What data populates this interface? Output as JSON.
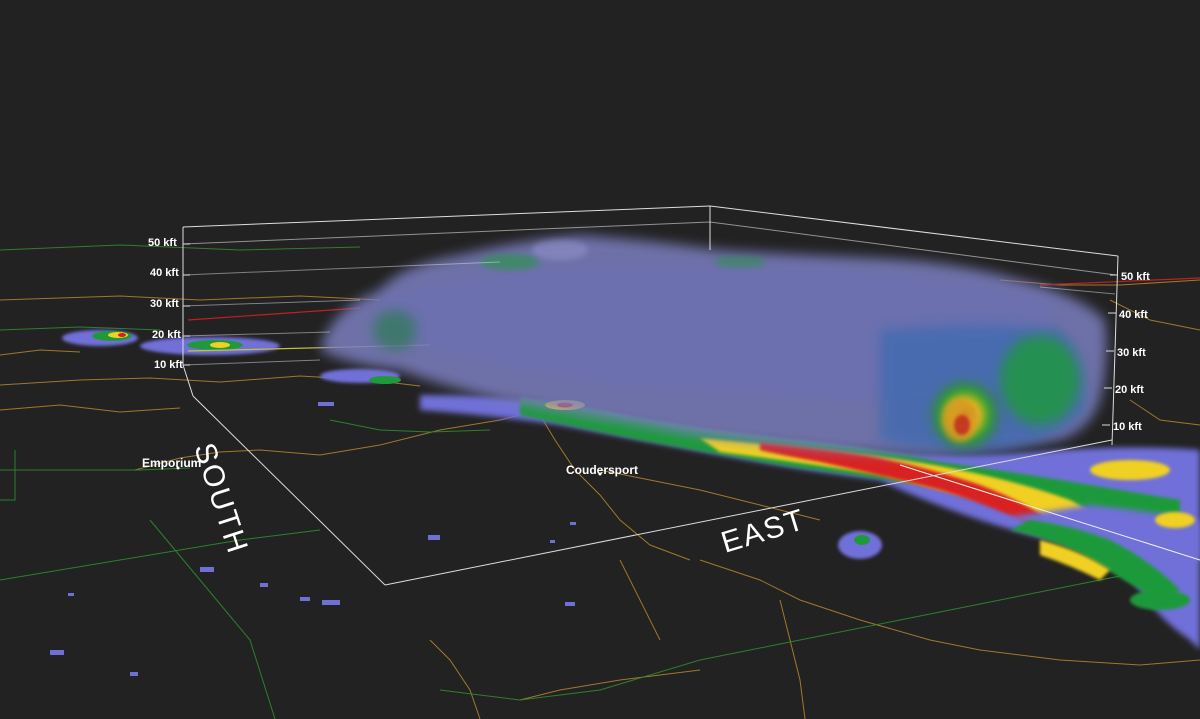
{
  "altitude_labels": {
    "left": [
      "50 kft",
      "40 kft",
      "30 kft",
      "20 kft",
      "10 kft"
    ],
    "right": [
      "50 kft",
      "40 kft",
      "30 kft",
      "20 kft",
      "10 kft"
    ]
  },
  "places": {
    "emporium": "Emporium",
    "coudersport": "Coudersport"
  },
  "compass": {
    "south": "SOUTH",
    "east": "EAST"
  },
  "colors": {
    "background": "#222222",
    "box_lines": "#dddddd",
    "county_lines": "#b8862e",
    "state_lines": "#2f8a2f",
    "reflectivity_low": "#6f6fd8",
    "reflectivity_mid": "#1f9a3a",
    "reflectivity_high": "#f0d020",
    "reflectivity_severe": "#d82020",
    "volume_haze": "#7c7fbf"
  }
}
